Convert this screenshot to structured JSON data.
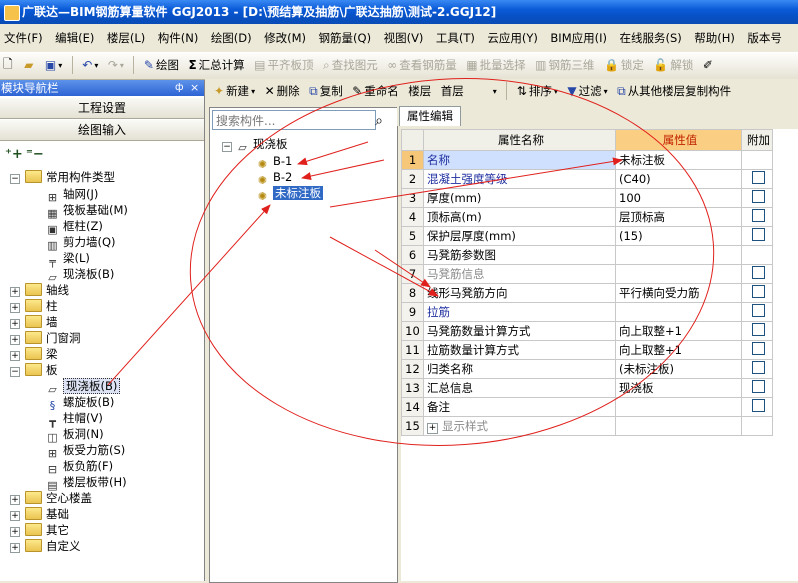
{
  "window": {
    "title": "广联达—BIM钢筋算量软件 GGJ2013 - [D:\\预结算及抽筋\\广联达抽筋\\测试-2.GGJ12]"
  },
  "menu": [
    "文件(F)",
    "编辑(E)",
    "楼层(L)",
    "构件(N)",
    "绘图(D)",
    "修改(M)",
    "钢筋量(Q)",
    "视图(V)",
    "工具(T)",
    "云应用(Y)",
    "BIM应用(I)",
    "在线服务(S)",
    "帮助(H)",
    "版本号"
  ],
  "toolbar": {
    "draw": "绘图",
    "sum": "汇总计算",
    "flush_slab": "平齐板顶",
    "find_element": "查找图元",
    "view_rebar": "查看钢筋量",
    "batch_select": "批量选择",
    "rebar_3d": "钢筋三维",
    "lock": "锁定",
    "unlock": "解锁"
  },
  "nav": {
    "header": "模块导航栏",
    "pin": "ф",
    "close": "×",
    "btn_project": "工程设置",
    "btn_draw": "绘图输入",
    "tree": {
      "common": "常用构件类型",
      "common_items": [
        "轴网(J)",
        "筏板基础(M)",
        "框柱(Z)",
        "剪力墙(Q)",
        "梁(L)",
        "现浇板(B)"
      ],
      "axis": "轴线",
      "column": "柱",
      "wall": "墙",
      "door": "门窗洞",
      "beam": "梁",
      "slab": "板",
      "slab_items": [
        "现浇板(B)",
        "螺旋板(B)",
        "柱帽(V)",
        "板洞(N)",
        "板受力筋(S)",
        "板负筋(F)",
        "楼层板带(H)"
      ],
      "hollow": "空心楼盖",
      "foundation": "基础",
      "other": "其它",
      "custom": "自定义"
    }
  },
  "comp_toolbar": {
    "new": "新建",
    "delete": "删除",
    "copy": "复制",
    "rename": "重命名",
    "floor_label": "楼层",
    "floor_value": "首层",
    "sort": "排序",
    "filter": "过滤",
    "copy_from": "从其他楼层复制构件"
  },
  "components": {
    "search_placeholder": "搜索构件...",
    "root": "现浇板",
    "items": [
      "B-1",
      "B-2",
      "未标注板"
    ]
  },
  "props": {
    "tab": "属性编辑",
    "headers": [
      "属性名称",
      "属性值",
      "附加"
    ],
    "rows": [
      {
        "n": "1",
        "name": "名称",
        "value": "未标注板"
      },
      {
        "n": "2",
        "name": "混凝土强度等级",
        "value": "(C40)"
      },
      {
        "n": "3",
        "name": "厚度(mm)",
        "value": "100"
      },
      {
        "n": "4",
        "name": "顶标高(m)",
        "value": "层顶标高"
      },
      {
        "n": "5",
        "name": "保护层厚度(mm)",
        "value": "(15)"
      },
      {
        "n": "6",
        "name": "马凳筋参数图",
        "value": ""
      },
      {
        "n": "7",
        "name": "马凳筋信息",
        "value": ""
      },
      {
        "n": "8",
        "name": "线形马凳筋方向",
        "value": "平行横向受力筋"
      },
      {
        "n": "9",
        "name": "拉筋",
        "value": ""
      },
      {
        "n": "10",
        "name": "马凳筋数量计算方式",
        "value": "向上取整+1"
      },
      {
        "n": "11",
        "name": "拉筋数量计算方式",
        "value": "向上取整+1"
      },
      {
        "n": "12",
        "name": "归类名称",
        "value": "(未标注板)"
      },
      {
        "n": "13",
        "name": "汇总信息",
        "value": "现浇板"
      },
      {
        "n": "14",
        "name": "备注",
        "value": ""
      },
      {
        "n": "15",
        "name": "显示样式",
        "value": ""
      }
    ]
  },
  "annotation_color": "#e0201c"
}
